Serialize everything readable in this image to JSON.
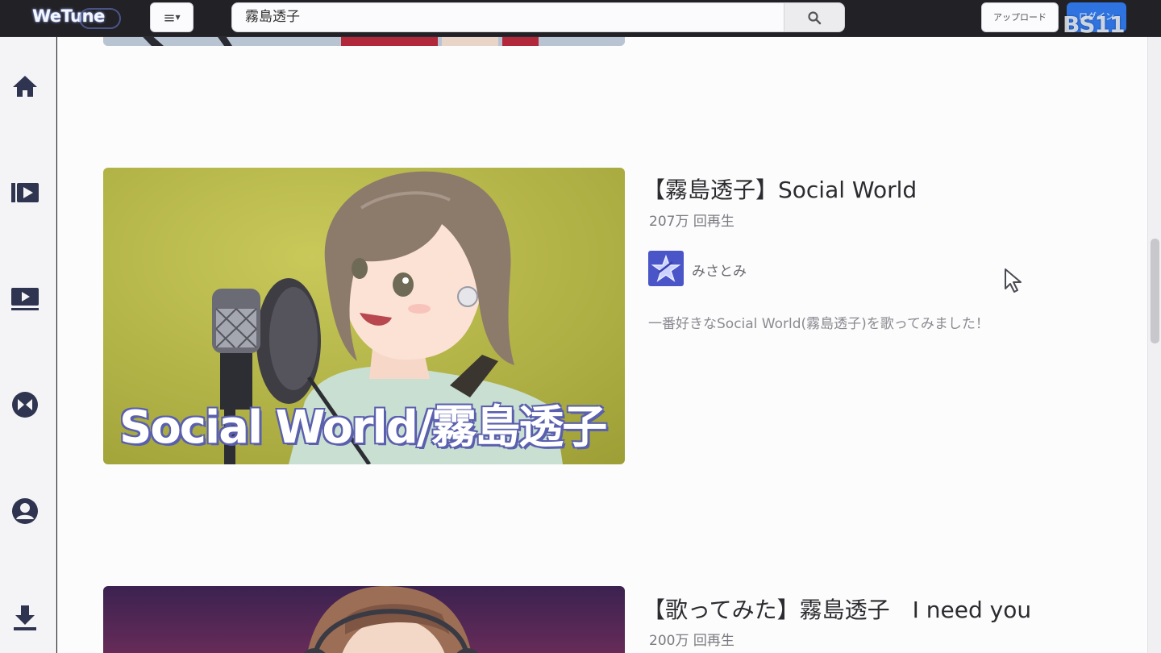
{
  "header": {
    "logo": "WeTune",
    "menu_label": "≡",
    "search_value": "霧島透子",
    "upload_label": "アップロード",
    "login_label": "ログイン",
    "watermark": "BS11"
  },
  "sidebar": {
    "items": [
      {
        "icon": "home-icon"
      },
      {
        "icon": "playlist-icon"
      },
      {
        "icon": "video-icon"
      },
      {
        "icon": "bowtie-icon"
      },
      {
        "icon": "account-icon"
      },
      {
        "icon": "download-icon"
      }
    ]
  },
  "videos": [
    {
      "title": "【霧島透子】Social World",
      "views": "207万 回再生",
      "channel": "みさとみ",
      "description": "一番好きなSocial World(霧島透子)を歌ってみました！",
      "thumbnail_caption": "Social World/霧島透子"
    },
    {
      "title": "【歌ってみた】霧島透子　I need you",
      "views": "200万 回再生"
    }
  ],
  "colors": {
    "accent": "#2f73e0",
    "topbar": "#222126",
    "sidebar_icon": "#2f3550",
    "thumbnail_bg": "#b3b33f",
    "channel_avatar": "#4a55c8"
  }
}
